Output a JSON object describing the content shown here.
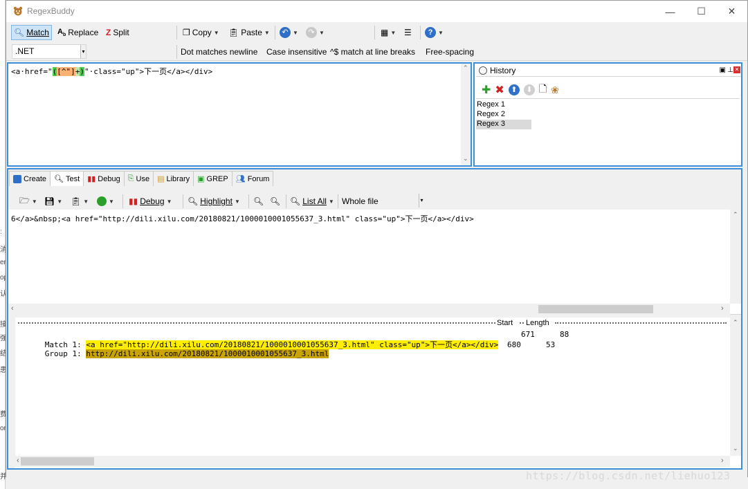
{
  "window": {
    "title": "RegexBuddy"
  },
  "toolbar": {
    "match": "Match",
    "replace": "Replace",
    "split": "Split",
    "copy": "Copy",
    "paste": "Paste"
  },
  "options": {
    "flavor": ".NET",
    "dot_newline": "Dot matches newline",
    "case_insensitive": "Case insensitive",
    "line_breaks": "^$ match at line breaks",
    "free_spacing": "Free-spacing"
  },
  "regex": {
    "part1": "<a·href=\"",
    "part2": "(",
    "part3": "[^\"]",
    "part4": "+",
    "part5": ")",
    "part6": "\"·class=\"up\">下一页</a></div>"
  },
  "history": {
    "title": "History",
    "items": [
      "Regex 1",
      "Regex 2",
      "Regex 3"
    ],
    "selected": 2
  },
  "tabs": [
    "Create",
    "Test",
    "Debug",
    "Use",
    "Library",
    "GREP",
    "Forum"
  ],
  "test_toolbar": {
    "debug": "Debug",
    "highlight": "Highlight",
    "list_all": "List All",
    "scope": "Whole file"
  },
  "test_text": "6</a>&nbsp;<a href=\"http://dili.xilu.com/20180821/1000010001055637_3.html\" class=\"up\">下一页</a></div>",
  "results": {
    "col_start": "Start",
    "col_length": "Length",
    "rows": [
      {
        "label": "Match 1:",
        "text": "<a href=\"http://dili.xilu.com/20180821/1000010001055637_3.html\" class=\"up\">下一页</a></div>",
        "start": "671",
        "length": "88"
      },
      {
        "label": "Group 1:",
        "text": "http://dili.xilu.com/20180821/1000010001055637_3.html",
        "start": "680",
        "length": "53"
      }
    ]
  },
  "watermark": "https://blog.csdn.net/liehuo123",
  "colors": {
    "accent": "#3b8fd9",
    "match": "#ffee00",
    "group": "#c9a400"
  }
}
